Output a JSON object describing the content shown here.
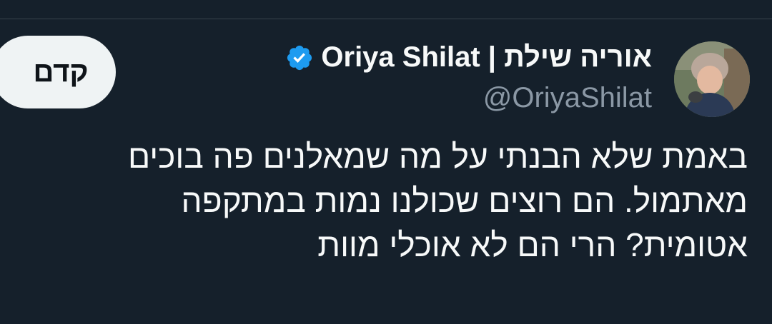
{
  "header": {
    "display_name": "Oriya Shilat | אוריה שילת",
    "handle": "@OriyaShilat",
    "follow_label": "קדם"
  },
  "tweet": {
    "lines": [
      "באמת שלא הבנתי על מה שמאלנים פה בוכים",
      "מאתמול. הם רוצים שכולנו נמות במתקפה",
      "אטומית? הרי הם לא אוכלי מוות"
    ]
  },
  "colors": {
    "background": "#15202b",
    "verified_blue": "#1d9bf0",
    "button_bg": "#eff3f4",
    "secondary_text": "#8b98a5"
  },
  "icons": {
    "verified": "verified-badge-icon",
    "more": "more-vertical-icon"
  }
}
